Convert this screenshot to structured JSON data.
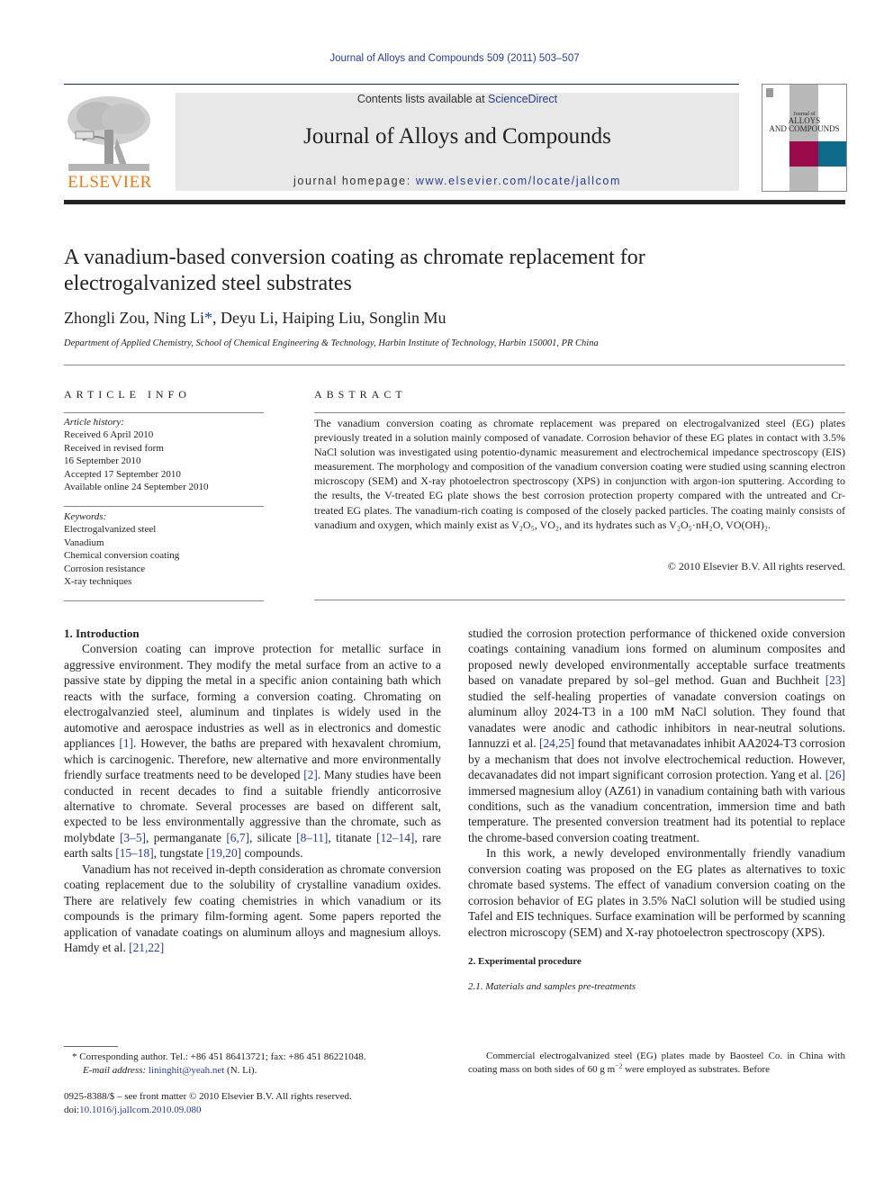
{
  "header": {
    "journal_ref": "Journal of Alloys and Compounds 509 (2011) 503–507",
    "contents_prefix": "Contents lists available at ",
    "contents_link": "ScienceDirect",
    "journal_title": "Journal of Alloys and Compounds",
    "homepage_prefix": "journal homepage: ",
    "homepage_url": "www.elsevier.com/locate/jallcom",
    "publisher_wordmark": "ELSEVIER",
    "cover": {
      "line1": "Journal of",
      "line2": "ALLOYS",
      "line3": "AND COMPOUNDS"
    }
  },
  "colors": {
    "link": "#2a3d8f",
    "elsevier_orange": "#e87a1e",
    "banner_gray": "#e8e8e8",
    "cover_magenta": "#9a0a4a",
    "cover_teal": "#0e6a8a"
  },
  "article": {
    "title_line1": "A vanadium-based conversion coating as chromate replacement for",
    "title_line2": "electrogalvanized steel substrates",
    "authors_before": "Zhongli Zou, Ning Li",
    "corresponding_mark": "*",
    "authors_after": ", Deyu Li, Haiping Liu, Songlin Mu",
    "affiliation": "Department of Applied Chemistry, School of Chemical Engineering & Technology, Harbin Institute of Technology, Harbin 150001, PR China"
  },
  "article_info": {
    "heading": "ARTICLE INFO",
    "history_label": "Article history:",
    "history": [
      "Received 6 April 2010",
      "Received in revised form",
      "16 September 2010",
      "Accepted 17 September 2010",
      "Available online 24 September 2010"
    ],
    "keywords_label": "Keywords:",
    "keywords": [
      "Electrogalvanized steel",
      "Vanadium",
      "Chemical conversion coating",
      "Corrosion resistance",
      "X-ray techniques"
    ]
  },
  "abstract": {
    "heading": "ABSTRACT",
    "text_main": "The vanadium conversion coating as chromate replacement was prepared on electrogalvanized steel (EG) plates previously treated in a solution mainly composed of vanadate. Corrosion behavior of these EG plates in contact with 3.5% NaCl solution was investigated using potentio-dynamic measurement and electrochemical impedance spectroscopy (EIS) measurement. The morphology and composition of the vanadium conversion coating were studied using scanning electron microscopy (SEM) and X-ray photoelectron spectroscopy (XPS) in conjunction with argon-ion sputtering. According to the results, the V-treated EG plate shows the best corrosion protection property compared with the untreated and Cr-treated EG plates. The vanadium-rich coating is composed of the closely packed particles. The coating mainly consists of vanadium and oxygen, which mainly exist as ",
    "formula_tail": "V₂O₅, VO₂, and its hydrates such as V₂O₅·nH₂O, VO(OH)₂.",
    "copyright": "© 2010 Elsevier B.V. All rights reserved."
  },
  "body": {
    "section1_heading": "1.  Introduction",
    "p1_a": "Conversion coating can improve protection for metallic surface in aggressive environment. They modify the metal surface from an active to a passive state by dipping the metal in a specific anion containing bath which reacts with the surface, forming a conversion coating. Chromating on electrogalvanzied steel, aluminum and tinplates is widely used in the automotive and aerospace industries as well as in electronics and domestic appliances ",
    "c1": "[1]",
    "p1_b": ". However, the baths are prepared with hexavalent chromium, which is carcinogenic. Therefore, new alternative and more environmentally friendly surface treatments need to be developed ",
    "c2": "[2]",
    "p1_c": ". Many studies have been conducted in recent decades to find a suitable friendly anticorrosive alternative to chromate. Several processes are based on different salt, expected to be less environmentally aggressive than the chromate, such as molybdate ",
    "c3": "[3–5]",
    "p1_d": ", permanganate ",
    "c4": "[6,7]",
    "p1_e": ", silicate ",
    "c5": "[8–11]",
    "p1_f": ", titanate ",
    "c6": "[12–14]",
    "p1_g": ", rare earth salts ",
    "c7": "[15–18]",
    "p1_h": ", tungstate ",
    "c8": "[19,20]",
    "p1_i": " compounds.",
    "p2_a": "Vanadium has not received in-depth consideration as chromate conversion coating replacement due to the solubility of crystalline vanadium oxides. There are relatively few coating chemistries in which vanadium or its compounds is the primary film-forming agent. Some papers reported the application of vanadate coatings on aluminum alloys and magnesium alloys. Hamdy et al. ",
    "c9": "[21,22]",
    "p2_b": " studied the corrosion protection performance of thickened oxide conversion coatings containing vanadium ions formed on aluminum composites and proposed newly developed environmentally acceptable surface treatments based on vanadate prepared by sol–gel method. Guan and Buchheit ",
    "c10": "[23]",
    "p2_c": " studied the self-healing properties of vanadate conversion coatings on aluminum alloy 2024-T3 in a 100 mM NaCl solution. They found that vanadates were anodic and cathodic inhibitors in near-neutral solutions. Iannuzzi et al. ",
    "c11": "[24,25]",
    "p2_d": " found that metavanadates inhibit AA2024-T3 corrosion by a mechanism that does not involve electrochemical reduction. However, decavanadates did not impart significant corrosion protection. Yang et al. ",
    "c12": "[26]",
    "p2_e": " immersed magnesium alloy (AZ61) in vanadium containing bath with various conditions, such as the vanadium concentration, immersion time and bath temperature. The presented conversion treatment had its potential to replace the chrome-based conversion coating treatment.",
    "p3": "In this work, a newly developed environmentally friendly vanadium conversion coating was proposed on the EG plates as alternatives to toxic chromate based systems. The effect of vanadium conversion coating on the corrosion behavior of EG plates in 3.5% NaCl solution will be studied using Tafel and EIS techniques. Surface examination will be performed by scanning electron microscopy (SEM) and X-ray photoelectron spectroscopy (XPS).",
    "section2_heading": "2.  Experimental procedure",
    "subsection21_heading": "2.1.  Materials and samples pre-treatments",
    "p4_a": "Commercial electrogalvanized steel (EG) plates made by Baosteel Co. in China with coating mass on both sides of 60 g m",
    "p4_sup": "−2",
    "p4_b": "  were employed as substrates. Before"
  },
  "footnote": {
    "mark": "*",
    "corresponding": " Corresponding author. Tel.: +86 451 86413721; fax: +86 451 86221048.",
    "email_label": "E-mail address:",
    "email": "lininghit@yeah.net",
    "email_suffix": " (N. Li).",
    "frontmatter": "0925-8388/$ – see front matter © 2010 Elsevier B.V. All rights reserved.",
    "doi_prefix": "doi:",
    "doi": "10.1016/j.jallcom.2010.09.080"
  }
}
